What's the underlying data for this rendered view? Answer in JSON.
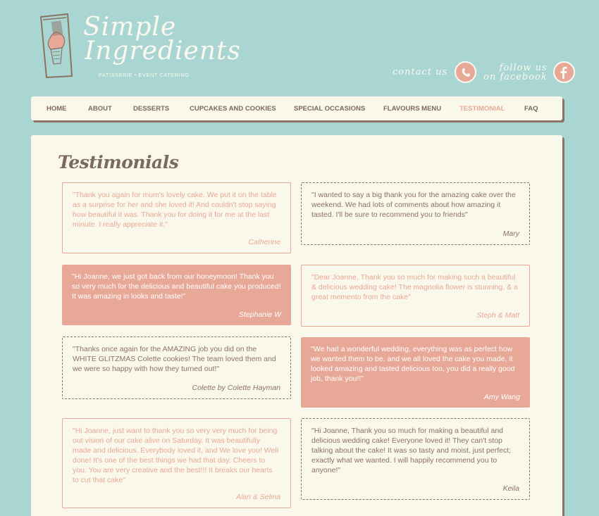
{
  "brand": {
    "line1": "Simple",
    "line2": "Ingredients",
    "tagline": "PATISSERIE • EVENT CATERING"
  },
  "header": {
    "contact_label": "contact us",
    "follow_label_1": "follow us",
    "follow_label_2": "on facebook"
  },
  "nav": {
    "items": [
      {
        "label": "HOME"
      },
      {
        "label": "ABOUT"
      },
      {
        "label": "DESSERTS"
      },
      {
        "label": "CUPCAKES AND COOKIES"
      },
      {
        "label": "SPECIAL OCCASIONS"
      },
      {
        "label": "FLAVOURS MENU"
      },
      {
        "label": "TESTIMONIAL",
        "active": true
      },
      {
        "label": "FAQ"
      }
    ]
  },
  "page": {
    "title": "Testimonials"
  },
  "testimonials": [
    {
      "quote": "\"Thank you again for mum's lovely cake. We put it on the table as a surprise for her and she loved it! And couldn't stop saying how beautiful it was. Thank you for doing it for me at the last minute. I really appreciate it.\"",
      "author": "Catherine",
      "style": "outline-pink"
    },
    {
      "quote": "\"I wanted to say a big thank you for the amazing cake over the weekend. We had lots of comments about how amazing it tasted. I'll be sure to recommend you to friends\"",
      "author": "Mary",
      "style": "dashed"
    },
    {
      "quote": "\"Hi Joanne, we just got back from our honeymoon! Thank you so very much for the delicious and beautiful cake you produced! It was amazing in looks and taste!\"",
      "author": "Stephanie W",
      "style": "filled-pink"
    },
    {
      "quote": "\"Dear Joanne, Thank you so much for making such a beautiful & delicious wedding cake! The magnolia flower is stunning, & a great memento from the cake\"",
      "author": "Steph & Matt",
      "style": "outline-pink"
    },
    {
      "quote": "\"Thanks once again for the AMAZING job you did on the WHITE GLITZMAS Colette cookies! The team loved them and we were so happy with how they turned out!\"",
      "author": "Colette by Colette Hayman",
      "style": "dashed"
    },
    {
      "quote": "\"We had a wonderful wedding, everything was as perfect how we wanted them to be, and we all loved the cake you made, it looked amazing and tasted delicious too, you did a really good job, thank you!!\"",
      "author": "Amy Wang",
      "style": "filled-pink"
    },
    {
      "quote": "\"Hi Joanne, just want to thank you so very very much for being out vision of our cake alive on Saturday. It was beautifully made and delicious. Everybody loved it, and We love you! Well done! It's one of the best things we had that day. Cheers to you. You are very creative and the best!!! It breaks our hearts to cut that cake\"",
      "author": "Alan & Selina",
      "style": "outline-pink"
    },
    {
      "quote": "\"Hi Joanne, Thank you so much for making a beautiful and delicious wedding cake! Everyone loved it! They can't stop talking about the cake! It was so tasty and moist, just perfect; exactly what we wanted. I will happily recommend you to anyone!\"",
      "author": "Keila",
      "style": "dashed"
    }
  ],
  "icons": {
    "phone": "phone-icon",
    "facebook": "facebook-icon",
    "logo": "cupcake-glass-logo"
  },
  "colors": {
    "background": "#a9d6d2",
    "panel": "#faf8ea",
    "accent_pink": "#e8a898",
    "brown": "#7c6a5c"
  }
}
